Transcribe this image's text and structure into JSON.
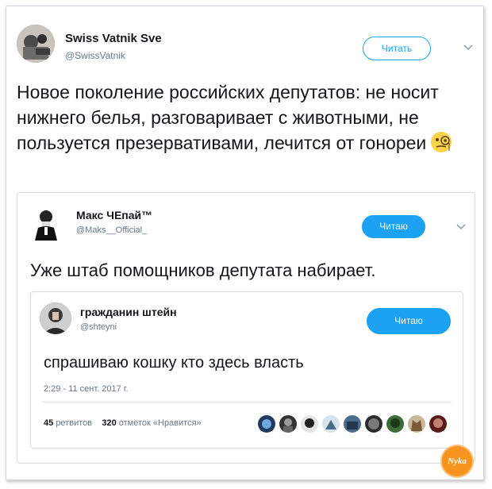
{
  "outer": {
    "name": "Swiss Vatnik Sve",
    "handle": "@SwissVatnik",
    "follow_label": "Читать",
    "text": "Новое поколение российских депутатов: не носит нижнего белья, разговаривает с животными, не пользуется презервативами, лечится от гонореи",
    "emoji_icon": "monocle-face-icon"
  },
  "quoted": {
    "name": "Макс ЧЕпай™",
    "handle": "@Maks__Official_",
    "follow_label": "Читаю",
    "text": "Уже штаб помощников депутата набирает."
  },
  "inner": {
    "name": "гражданин штейн",
    "handle": "@shteyni",
    "follow_label": "Читаю",
    "text": "спрашиваю кошку кто здесь власть",
    "timestamp": "2:29 - 11 сент. 2017 г.",
    "retweets_count": "45",
    "retweets_label": "ретвитов",
    "likes_count": "320",
    "likes_label": "отметок «Нравится»"
  },
  "watermark": "Nyka",
  "colors": {
    "accent": "#1da1f2",
    "text": "#14171a",
    "muted": "#657786",
    "watermark": "#f7941d"
  }
}
